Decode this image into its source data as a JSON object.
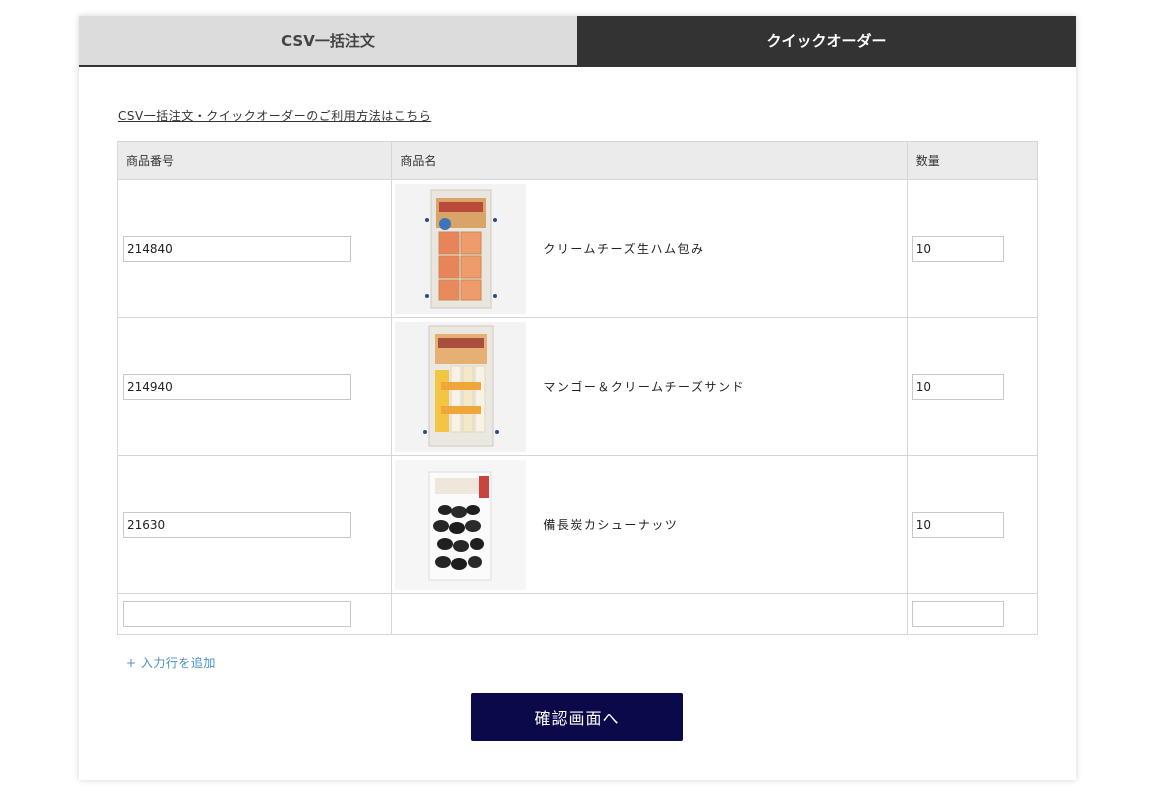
{
  "tabs": {
    "csv_label": "CSV一括注文",
    "quick_label": "クイックオーダー"
  },
  "help_link": "CSV一括注文・クイックオーダーのご利用方法はこちら",
  "table": {
    "headers": {
      "code": "商品番号",
      "name": "商品名",
      "qty": "数量"
    },
    "rows": [
      {
        "code": "214840",
        "name": "クリームチーズ生ハム包み",
        "qty": "10",
        "thumb_icon": "product-ham-cheese-package-image"
      },
      {
        "code": "214940",
        "name": "マンゴー＆クリームチーズサンド",
        "qty": "10",
        "thumb_icon": "product-mango-cheese-package-image"
      },
      {
        "code": "21630",
        "name": "備長炭カシューナッツ",
        "qty": "10",
        "thumb_icon": "product-charcoal-cashew-package-image"
      }
    ],
    "empty_row": {
      "code": "",
      "qty": ""
    }
  },
  "add_row_label": "+ 入力行を追加",
  "confirm_button": "確認画面へ",
  "colors": {
    "active_tab": "#333333",
    "inactive_tab": "#dcdcdc",
    "confirm_button": "#0a0a4a",
    "add_row_link": "#4a90c8"
  }
}
